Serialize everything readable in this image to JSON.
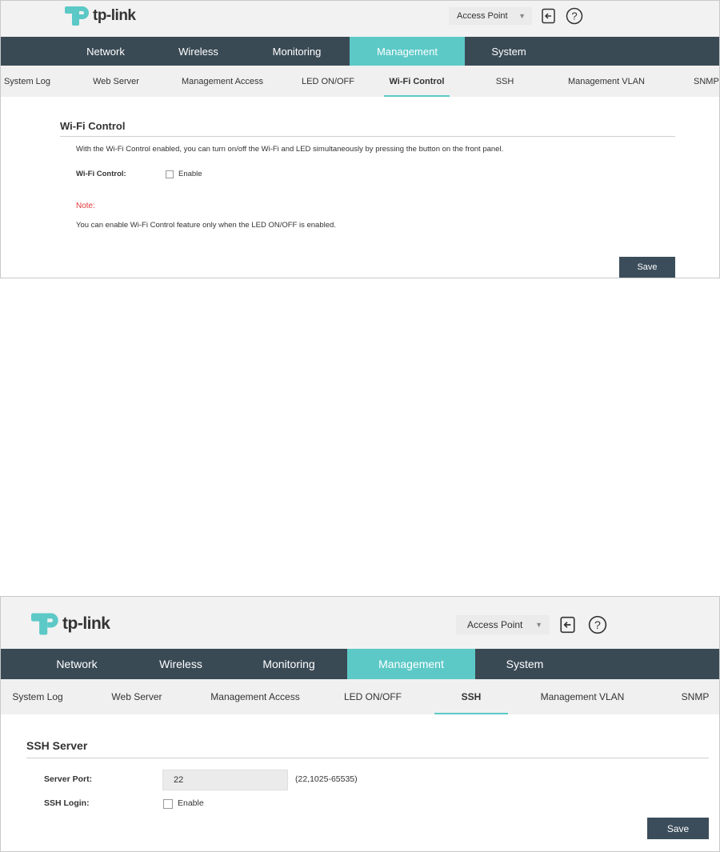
{
  "brand": {
    "name": "tp-link",
    "color": "#5cc9c7"
  },
  "colors": {
    "nav_bg": "#3a4a55",
    "accent": "#5cc9c7",
    "note": "#e03a3a",
    "button": "#3b4d5a"
  },
  "panel1": {
    "header": {
      "mode": "Access Point",
      "icons": [
        "logout-icon",
        "help-icon"
      ]
    },
    "main_nav": [
      "Network",
      "Wireless",
      "Monitoring",
      "Management",
      "System"
    ],
    "main_nav_active": "Management",
    "sub_nav": [
      "System Log",
      "Web Server",
      "Management Access",
      "LED ON/OFF",
      "Wi-Fi Control",
      "SSH",
      "Management VLAN",
      "SNMP"
    ],
    "sub_nav_active": "Wi-Fi Control",
    "section_title": "Wi-Fi Control",
    "description": "With the Wi-Fi Control enabled, you can turn on/off the Wi-Fi and LED simultaneously by pressing the button on the front panel.",
    "field_label": "Wi-Fi Control:",
    "checkbox_label": "Enable",
    "checkbox_checked": false,
    "note_label": "Note:",
    "note_text": "You can enable Wi-Fi Control feature only when the LED ON/OFF is enabled.",
    "save_label": "Save"
  },
  "panel2": {
    "header": {
      "mode": "Access Point",
      "icons": [
        "logout-icon",
        "help-icon"
      ]
    },
    "main_nav": [
      "Network",
      "Wireless",
      "Monitoring",
      "Management",
      "System"
    ],
    "main_nav_active": "Management",
    "sub_nav": [
      "System Log",
      "Web Server",
      "Management Access",
      "LED ON/OFF",
      "SSH",
      "Management VLAN",
      "SNMP"
    ],
    "sub_nav_active": "SSH",
    "section_title": "SSH Server",
    "server_port_label": "Server Port:",
    "server_port_value": "22",
    "server_port_hint": "(22,1025-65535)",
    "ssh_login_label": "SSH Login:",
    "checkbox_label": "Enable",
    "checkbox_checked": false,
    "save_label": "Save"
  }
}
